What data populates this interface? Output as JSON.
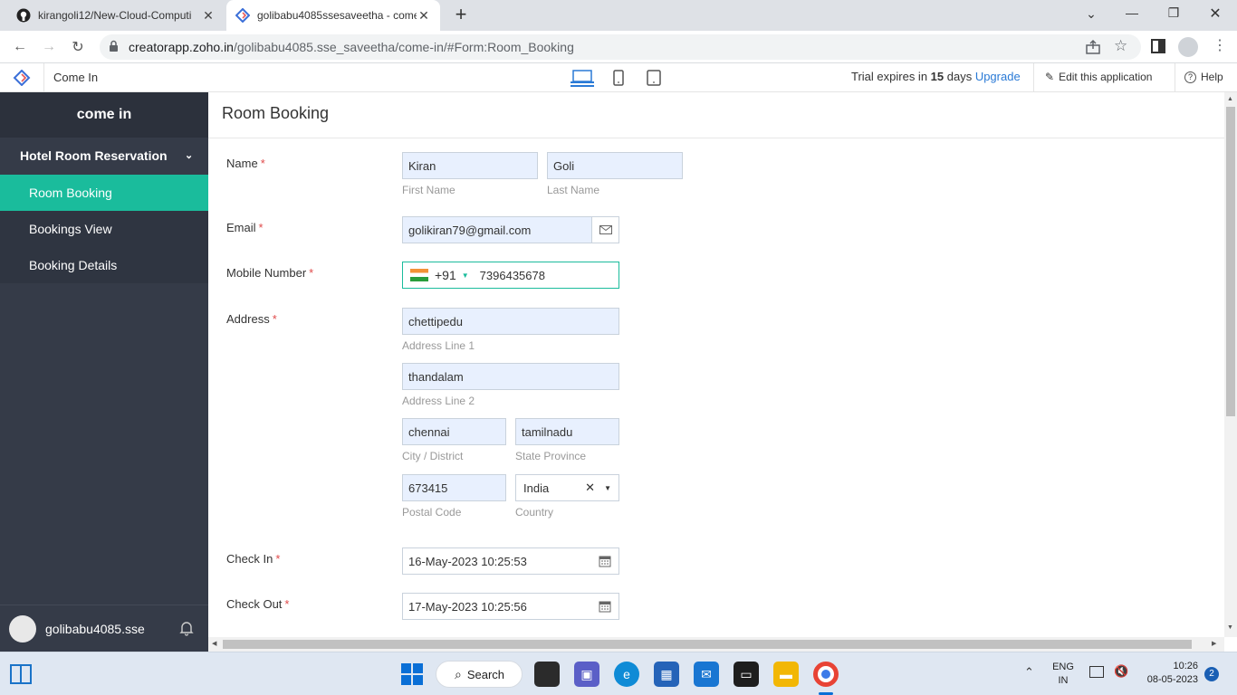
{
  "browser": {
    "tabs": [
      {
        "title": "kirangoli12/New-Cloud-Computi",
        "close": "✕"
      },
      {
        "title": "golibabu4085ssesaveetha - come",
        "close": "✕"
      }
    ],
    "new_tab": "+",
    "url_host": "creatorapp.zoho.in",
    "url_path": "/golibabu4085.sse_saveetha/come-in/#Form:Room_Booking",
    "window_controls": [
      "⌄",
      "—",
      "❐",
      "✕"
    ]
  },
  "app_header": {
    "app_name": "Come In",
    "trial_prefix": "Trial expires in ",
    "trial_days": "15",
    "trial_suffix": " days ",
    "upgrade": "Upgrade",
    "edit": "Edit this application",
    "help": "Help"
  },
  "sidebar": {
    "title": "come in",
    "section": "Hotel Room Reservation",
    "items": [
      {
        "label": "Room Booking",
        "active": true
      },
      {
        "label": "Bookings View",
        "active": false
      },
      {
        "label": "Booking Details",
        "active": false
      }
    ],
    "user": "golibabu4085.sse"
  },
  "form": {
    "title": "Room Booking",
    "name_label": "Name",
    "first_name": "Kiran",
    "first_name_hint": "First Name",
    "last_name": "Goli",
    "last_name_hint": "Last Name",
    "email_label": "Email",
    "email": "golikiran79@gmail.com",
    "mobile_label": "Mobile Number",
    "dial_code": "+91",
    "mobile": "7396435678",
    "address_label": "Address",
    "address1": "chettipedu",
    "address1_hint": "Address Line 1",
    "address2": "thandalam",
    "address2_hint": "Address Line 2",
    "city": "chennai",
    "city_hint": "City / District",
    "state": "tamilnadu",
    "state_hint": "State Province",
    "postal": "673415",
    "postal_hint": "Postal Code",
    "country": "India",
    "country_hint": "Country",
    "checkin_label": "Check In",
    "checkin": "16-May-2023 10:25:53",
    "checkout_label": "Check Out",
    "checkout": "17-May-2023 10:25:56",
    "required_mark": "*"
  },
  "taskbar": {
    "search": "Search",
    "lang1": "ENG",
    "lang2": "IN",
    "time": "10:26",
    "date": "08-05-2023",
    "notif": "2"
  },
  "colors": {
    "sidebar_bg": "#353b48",
    "active_item": "#1abc9c",
    "link": "#2a7ad6",
    "required": "#e04b4b"
  }
}
